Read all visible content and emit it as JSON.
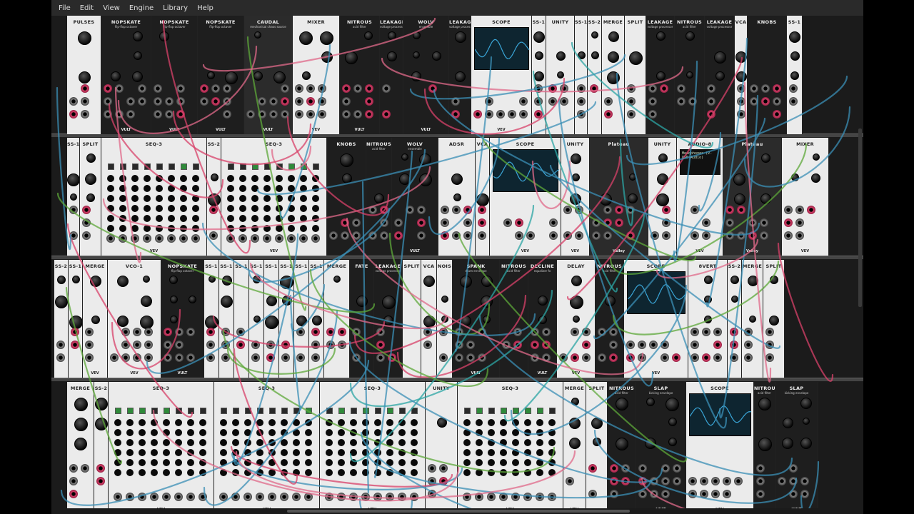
{
  "menu": [
    "File",
    "Edit",
    "View",
    "Engine",
    "Library",
    "Help"
  ],
  "rows": [
    {
      "modules": [
        {
          "title": "PULSES",
          "w": 48,
          "style": "light"
        },
        {
          "title": "NOPSKATE",
          "sub": "flip-flop octaver",
          "w": 70,
          "style": "dark",
          "foot": "VULT"
        },
        {
          "title": "NOPSKATE",
          "sub": "flip-flop octaver",
          "w": 65,
          "style": "dark",
          "foot": "VULT"
        },
        {
          "title": "NOPSKATE",
          "sub": "flip-flop octaver",
          "w": 65,
          "style": "dark",
          "foot": "VULT"
        },
        {
          "title": "CAUDAL",
          "sub": "mechanical chaos source",
          "w": 68,
          "style": "darkgrey",
          "foot": "VULT"
        },
        {
          "title": "MIXER",
          "w": 66,
          "style": "light",
          "foot": "VEV"
        },
        {
          "title": "NITROUS",
          "sub": "acid filter",
          "w": 56,
          "style": "dark",
          "foot": "VULT"
        },
        {
          "title": "LEAKAGE",
          "sub": "voltage processor",
          "w": 33,
          "style": "dark"
        },
        {
          "title": "WOLV",
          "sub": "ensemble",
          "w": 64,
          "style": "dark",
          "foot": "VULT"
        },
        {
          "title": "LEAKAGE",
          "sub": "voltage processor",
          "w": 31,
          "style": "dark"
        },
        {
          "title": "SCOPE",
          "w": 85,
          "style": "light",
          "foot": "VEV",
          "scope": true
        },
        {
          "title": "SS-1",
          "w": 20,
          "style": "light"
        },
        {
          "title": "UNITY",
          "w": 40,
          "style": "light"
        },
        {
          "title": "SS-1",
          "w": 18,
          "style": "light"
        },
        {
          "title": "SS-2",
          "w": 20,
          "style": "light"
        },
        {
          "title": "MERGE",
          "w": 32,
          "style": "light"
        },
        {
          "title": "SPLIT",
          "w": 30,
          "style": "light"
        },
        {
          "title": "LEAKAGE",
          "sub": "voltage processor",
          "w": 40,
          "style": "dark"
        },
        {
          "title": "NITROUS",
          "sub": "acid filter",
          "w": 42,
          "style": "dark"
        },
        {
          "title": "LEAKAGE",
          "sub": "voltage processor",
          "w": 42,
          "style": "dark"
        },
        {
          "title": "VCA",
          "w": 18,
          "style": "light"
        },
        {
          "title": "KNOBS",
          "w": 55,
          "style": "dark"
        },
        {
          "title": "SS-1",
          "w": 22,
          "style": "light"
        }
      ]
    },
    {
      "modules": [
        {
          "title": "SS-1",
          "w": 18,
          "style": "light"
        },
        {
          "title": "SPLIT",
          "w": 30,
          "style": "light"
        },
        {
          "title": "SEQ-3",
          "w": 148,
          "style": "light",
          "foot": "VEV"
        },
        {
          "title": "SS-2",
          "w": 20,
          "style": "light"
        },
        {
          "title": "SEQ-3",
          "w": 148,
          "style": "light",
          "foot": "VEV"
        },
        {
          "title": "KNOBS",
          "w": 55,
          "style": "dark"
        },
        {
          "title": "NITROUS",
          "sub": "acid filter",
          "w": 36,
          "style": "dark"
        },
        {
          "title": "WOLV",
          "sub": "ensemble",
          "w": 65,
          "style": "dark",
          "foot": "VULT"
        },
        {
          "title": "ADSR",
          "w": 52,
          "style": "light"
        },
        {
          "title": "VCA",
          "w": 20,
          "style": "light"
        },
        {
          "title": "SCOPE",
          "w": 100,
          "style": "light",
          "foot": "VEV",
          "scope": true
        },
        {
          "title": "UNITY",
          "w": 40,
          "style": "light",
          "foot": "VEV"
        },
        {
          "title": "Plateau",
          "w": 82,
          "style": "darkgrey",
          "foot": "Valley"
        },
        {
          "title": "UNITY",
          "w": 40,
          "style": "light"
        },
        {
          "title": "AUDIO-8",
          "w": 65,
          "style": "light",
          "lcd": "Headphones (2- USB Audio)",
          "foot": "VEV"
        },
        {
          "title": "Plateau",
          "w": 82,
          "style": "darkgrey",
          "foot": "Valley"
        },
        {
          "title": "MIXER",
          "w": 66,
          "style": "light",
          "foot": "VEV"
        }
      ]
    },
    {
      "modules": [
        {
          "title": "SS-2",
          "w": 20,
          "style": "light"
        },
        {
          "title": "SS-1",
          "w": 20,
          "style": "light"
        },
        {
          "title": "MERGE",
          "w": 35,
          "style": "light",
          "foot": "VEV"
        },
        {
          "title": "VCO-1",
          "w": 75,
          "style": "light",
          "foot": "VEV"
        },
        {
          "title": "NOPSKATE",
          "sub": "flip-flop octaver",
          "w": 60,
          "style": "dark",
          "foot": "VULT"
        },
        {
          "title": "SS-1",
          "w": 21,
          "style": "light"
        },
        {
          "title": "SS-1",
          "w": 21,
          "style": "light"
        },
        {
          "title": "SS-1",
          "w": 21,
          "style": "light"
        },
        {
          "title": "SS-1",
          "w": 21,
          "style": "light"
        },
        {
          "title": "SS-1",
          "w": 21,
          "style": "light"
        },
        {
          "title": "SS-1",
          "w": 21,
          "style": "light"
        },
        {
          "title": "SS-1",
          "w": 21,
          "style": "light"
        },
        {
          "title": "SS-1",
          "w": 21,
          "style": "light"
        },
        {
          "title": "MERGE",
          "w": 36,
          "style": "light"
        },
        {
          "title": "FATE",
          "w": 34,
          "style": "dark"
        },
        {
          "title": "LEAKAGE",
          "sub": "voltage processor",
          "w": 40,
          "style": "dark"
        },
        {
          "title": "SPLIT",
          "w": 26,
          "style": "light"
        },
        {
          "title": "VCA",
          "w": 22,
          "style": "light"
        },
        {
          "title": "NOIS",
          "w": 22,
          "style": "light"
        },
        {
          "title": "SPANK",
          "sub": "drum envelope",
          "w": 66,
          "style": "dark",
          "foot": "VULT"
        },
        {
          "title": "NITROUS",
          "sub": "acid filter",
          "w": 40,
          "style": "dark"
        },
        {
          "title": "DECLINE",
          "sub": "equalizer fx",
          "w": 40,
          "style": "dark",
          "foot": "VULT"
        },
        {
          "title": "DELAY",
          "w": 54,
          "style": "light",
          "foot": "VEV"
        },
        {
          "title": "NITROUS",
          "sub": "acid filter",
          "w": 40,
          "style": "dark"
        },
        {
          "title": "SCOPE",
          "w": 90,
          "style": "light",
          "foot": "VEV",
          "scope": true
        },
        {
          "title": "8VERT",
          "w": 55,
          "style": "light"
        },
        {
          "title": "SS-2",
          "w": 20,
          "style": "light"
        },
        {
          "title": "MERGE",
          "w": 30,
          "style": "light"
        },
        {
          "title": "SPLIT",
          "w": 30,
          "style": "light"
        }
      ]
    },
    {
      "modules": [
        {
          "title": "MERGE",
          "w": 38,
          "style": "light"
        },
        {
          "title": "SS-2",
          "w": 20,
          "style": "light"
        },
        {
          "title": "SEQ-3",
          "w": 148,
          "style": "light",
          "foot": "VEV"
        },
        {
          "title": "SEQ-3",
          "w": 148,
          "style": "light",
          "foot": "VEV"
        },
        {
          "title": "SEQ-3",
          "w": 148,
          "style": "light",
          "foot": "VEV"
        },
        {
          "title": "UNITY",
          "w": 45,
          "style": "light"
        },
        {
          "title": "SEQ-3",
          "w": 148,
          "style": "light",
          "foot": "VEV"
        },
        {
          "title": "MERGE",
          "w": 32,
          "style": "light",
          "foot": "VEV"
        },
        {
          "title": "SPLIT",
          "w": 30,
          "style": "light"
        },
        {
          "title": "NITROUS",
          "sub": "acid filter",
          "w": 40,
          "style": "dark"
        },
        {
          "title": "SLAP",
          "sub": "kicking envelope",
          "w": 70,
          "style": "dark",
          "foot": "VULT"
        },
        {
          "title": "SCOPE",
          "w": 95,
          "style": "light",
          "foot": "VEV",
          "scope": true
        },
        {
          "title": "NITROUS",
          "sub": "acid filter",
          "w": 30,
          "style": "dark"
        },
        {
          "title": "SLAP",
          "sub": "kicking envelope",
          "w": 60,
          "style": "dark",
          "foot": "VULT"
        }
      ]
    }
  ],
  "colors": {
    "cable_blue": "#3b8fb5",
    "cable_red": "#d8416a",
    "cable_green": "#5ea83a",
    "cable_pink": "#e06a8a",
    "cable_teal": "#2ca6a4",
    "scope_screen": "#0e2530",
    "scope_wave": "#3aa6d8"
  }
}
